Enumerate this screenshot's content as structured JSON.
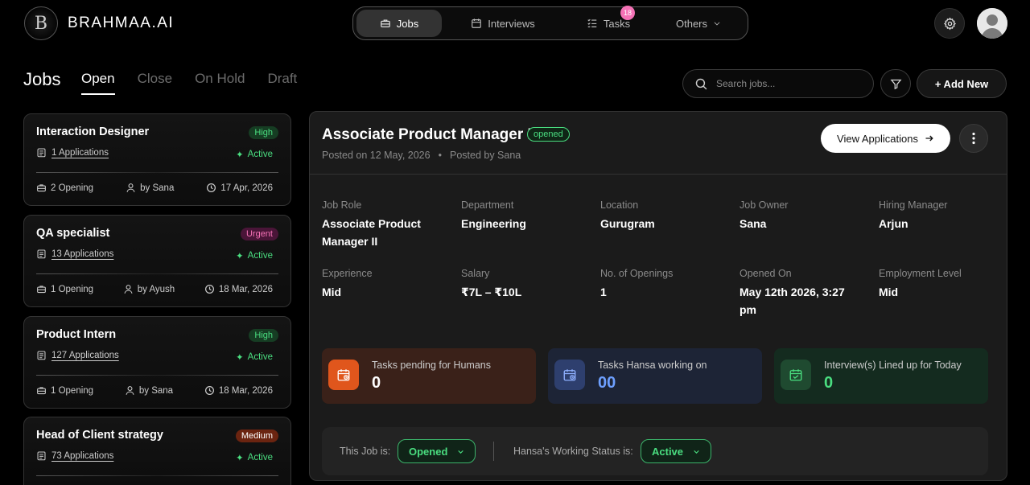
{
  "app": {
    "logo_letter": "B",
    "name": "BRAHMAA.AI"
  },
  "topnav": {
    "items": [
      {
        "label": "Jobs",
        "icon": "briefcase-icon",
        "active": true
      },
      {
        "label": "Interviews",
        "icon": "calendar-icon"
      },
      {
        "label": "Tasks",
        "icon": "task-list-icon",
        "badge": "18"
      },
      {
        "label": "Others",
        "icon": "chevron-down-icon"
      }
    ]
  },
  "page": {
    "title": "Jobs",
    "tabs": [
      "Open",
      "Close",
      "On Hold",
      "Draft"
    ],
    "active_tab": "Open"
  },
  "search": {
    "placeholder": "Search jobs..."
  },
  "actions": {
    "add_new": "+ Add New"
  },
  "jobs": [
    {
      "title": "Interaction Designer",
      "priority": "High",
      "applications": "1 Applications",
      "status": "Active",
      "openings": "2 Opening",
      "by": "by Sana",
      "date": "17 Apr, 2026"
    },
    {
      "title": "QA specialist",
      "priority": "Urgent",
      "applications": "13 Applications",
      "status": "Active",
      "openings": "1 Opening",
      "by": "by Ayush",
      "date": "18 Mar, 2026"
    },
    {
      "title": "Product Intern",
      "priority": "High",
      "applications": "127 Applications",
      "status": "Active",
      "openings": "1 Opening",
      "by": "by Sana",
      "date": "18 Mar, 2026"
    },
    {
      "title": "Head of Client strategy",
      "priority": "Medium",
      "applications": "73 Applications",
      "status": "Active"
    }
  ],
  "detail": {
    "title": "Associate Product Manager II",
    "status": "opened",
    "posted_on": "Posted on 12 May, 2026",
    "posted_by": "Posted by Sana",
    "separator": "•",
    "view_applications": "View Applications",
    "fields": [
      {
        "label": "Job Role",
        "value": "Associate Product Manager II"
      },
      {
        "label": "Department",
        "value": "Engineering"
      },
      {
        "label": "Location",
        "value": "Gurugram"
      },
      {
        "label": "Job Owner",
        "value": "Sana"
      },
      {
        "label": "Hiring Manager",
        "value": "Arjun"
      },
      {
        "label": "Experience",
        "value": "Mid"
      },
      {
        "label": "Salary",
        "value": "₹7L – ₹10L"
      },
      {
        "label": "No. of Openings",
        "value": "1"
      },
      {
        "label": "Opened On",
        "value": "May 12th 2026, 3:27 pm"
      },
      {
        "label": "Employment Level",
        "value": "Mid"
      }
    ],
    "stats": [
      {
        "label": "Tasks pending for Humans",
        "value": "0",
        "bg": "#3a2119",
        "icon_bg": "#e0561c",
        "color": "#ffffff"
      },
      {
        "label": "Tasks Hansa working on",
        "value": "00",
        "bg": "#1d2436",
        "icon_bg": "#2e3f6e",
        "color": "#6ea0ff"
      },
      {
        "label": "Interview(s) Lined up for Today",
        "value": "0",
        "bg": "#142b1f",
        "icon_bg": "#1f4a30",
        "color": "#4ade80"
      }
    ],
    "job_status_label": "This Job is:",
    "job_status_value": "Opened",
    "hansa_status_label": "Hansa's Working Status is:",
    "hansa_status_value": "Active"
  }
}
